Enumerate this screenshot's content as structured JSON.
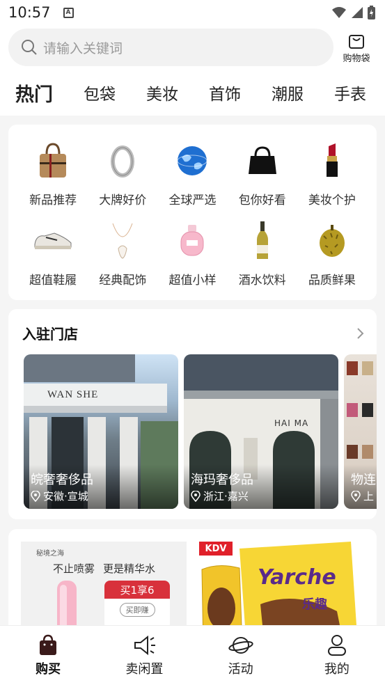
{
  "status": {
    "time": "10:57"
  },
  "search": {
    "placeholder": "请输入关键词"
  },
  "bag": {
    "label": "购物袋"
  },
  "tabs": [
    "热门",
    "包袋",
    "美妆",
    "首饰",
    "潮服",
    "手表"
  ],
  "categories": [
    {
      "label": "新品推荐",
      "icon": "handbag-icon"
    },
    {
      "label": "大牌好价",
      "icon": "ring-icon"
    },
    {
      "label": "全球严选",
      "icon": "globe-icon"
    },
    {
      "label": "包你好看",
      "icon": "black-bag-icon"
    },
    {
      "label": "美妆个护",
      "icon": "lipstick-icon"
    },
    {
      "label": "超值鞋履",
      "icon": "sneaker-icon"
    },
    {
      "label": "经典配饰",
      "icon": "necklace-icon"
    },
    {
      "label": "超值小样",
      "icon": "perfume-icon"
    },
    {
      "label": "酒水饮料",
      "icon": "wine-bottle-icon"
    },
    {
      "label": "品质鲜果",
      "icon": "durian-icon"
    }
  ],
  "stores": {
    "title": "入驻门店",
    "items": [
      {
        "name": "皖奢奢侈品",
        "location": "安徽·宣城",
        "sign": "WAN SHE"
      },
      {
        "name": "海玛奢侈品",
        "location": "浙江·嘉兴",
        "sign": "HAI MA"
      },
      {
        "name": "物连",
        "location": "上"
      }
    ]
  },
  "promos": {
    "p1": {
      "brand": "秘境之海",
      "line1": "不止喷雾",
      "line2": "更是精华水",
      "badge": "买1享6",
      "button": "买即赚"
    },
    "p2": {
      "brand": "KDV",
      "product": "Yarche",
      "cn": "乐趣"
    }
  },
  "nav": [
    {
      "label": "购买",
      "icon": "shopping-bag-icon"
    },
    {
      "label": "卖闲置",
      "icon": "megaphone-icon"
    },
    {
      "label": "活动",
      "icon": "planet-icon"
    },
    {
      "label": "我的",
      "icon": "user-icon"
    }
  ]
}
